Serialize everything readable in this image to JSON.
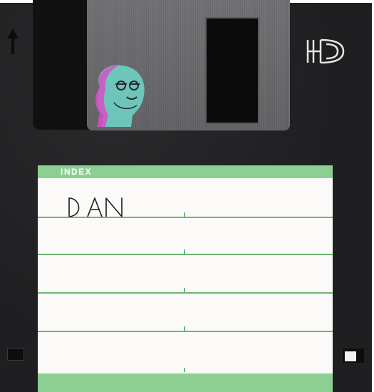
{
  "disk": {
    "label_header": "INDEX",
    "handwritten_name": "DAN",
    "density_logo": "HD",
    "label_line_count": 5
  },
  "colors": {
    "casing": "#1f1f21",
    "shutter": "#a5a5a7",
    "label_paper": "#fbfaf8",
    "label_green": "#8ccf93",
    "line_green": "#6ab874",
    "sticker_cyan": "#6fd6c9",
    "sticker_magenta": "#d74fc8"
  },
  "icons": {
    "write_direction": "arrow-up-icon",
    "density": "hd-logo-icon",
    "sticker": "portrait-sticker-icon"
  }
}
